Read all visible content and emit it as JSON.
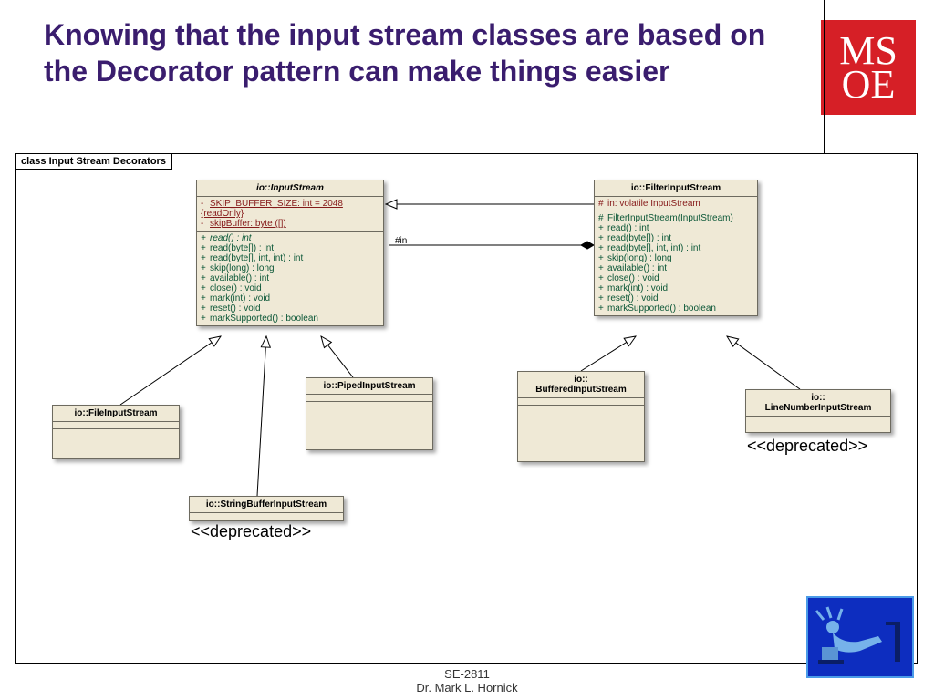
{
  "title": "Knowing that the input stream classes are based on the Decorator pattern can make things easier",
  "logo": {
    "r1": "MS",
    "r2": "OE"
  },
  "diagram_label": "class Input Stream Decorators",
  "edge_labels": {
    "in": "#in"
  },
  "classes": {
    "inputstream": {
      "name": "io::InputStream",
      "attrs": [
        {
          "vis": "-",
          "text": "SKIP_BUFFER_SIZE:  int = 2048 {readOnly}",
          "static": true
        },
        {
          "vis": "-",
          "text": "skipBuffer:  byte ([])",
          "static": true
        }
      ],
      "ops": [
        {
          "vis": "+",
          "text": "read() : int",
          "italic": true
        },
        {
          "vis": "+",
          "text": "read(byte[]) : int"
        },
        {
          "vis": "+",
          "text": "read(byte[], int, int) : int"
        },
        {
          "vis": "+",
          "text": "skip(long) : long"
        },
        {
          "vis": "+",
          "text": "available() : int"
        },
        {
          "vis": "+",
          "text": "close() : void"
        },
        {
          "vis": "+",
          "text": "mark(int) : void"
        },
        {
          "vis": "+",
          "text": "reset() : void"
        },
        {
          "vis": "+",
          "text": "markSupported() : boolean"
        }
      ]
    },
    "filter": {
      "name": "io::FilterInputStream",
      "attrs": [
        {
          "vis": "#",
          "text": "in:  volatile InputStream"
        }
      ],
      "ops": [
        {
          "vis": "#",
          "text": "FilterInputStream(InputStream)"
        },
        {
          "vis": "+",
          "text": "read() : int"
        },
        {
          "vis": "+",
          "text": "read(byte[]) : int"
        },
        {
          "vis": "+",
          "text": "read(byte[], int, int) : int"
        },
        {
          "vis": "+",
          "text": "skip(long) : long"
        },
        {
          "vis": "+",
          "text": "available() : int"
        },
        {
          "vis": "+",
          "text": "close() : void"
        },
        {
          "vis": "+",
          "text": "mark(int) : void"
        },
        {
          "vis": "+",
          "text": "reset() : void"
        },
        {
          "vis": "+",
          "text": "markSupported() : boolean"
        }
      ]
    },
    "file": {
      "name": "io::FileInputStream"
    },
    "stringbuf": {
      "name": "io::StringBufferInputStream"
    },
    "piped": {
      "name": "io::PipedInputStream"
    },
    "buffered": {
      "name": "io::\nBufferedInputStream"
    },
    "linenum": {
      "name": "io::\nLineNumberInputStream"
    }
  },
  "annotations": {
    "dep1": "<<deprecated>>",
    "dep2": "<<deprecated>>"
  },
  "footer": {
    "course": "SE-2811",
    "author": "Dr. Mark L. Hornick"
  },
  "chart_data": {
    "type": "table",
    "description": "UML class diagram illustrating Java io InputStream hierarchy as Decorator pattern",
    "nodes": [
      {
        "id": "InputStream",
        "abstract": true
      },
      {
        "id": "FilterInputStream"
      },
      {
        "id": "FileInputStream"
      },
      {
        "id": "StringBufferInputStream",
        "stereotype": "deprecated"
      },
      {
        "id": "PipedInputStream"
      },
      {
        "id": "BufferedInputStream"
      },
      {
        "id": "LineNumberInputStream",
        "stereotype": "deprecated"
      }
    ],
    "edges": [
      {
        "from": "FilterInputStream",
        "to": "InputStream",
        "type": "generalization"
      },
      {
        "from": "FileInputStream",
        "to": "InputStream",
        "type": "generalization"
      },
      {
        "from": "StringBufferInputStream",
        "to": "InputStream",
        "type": "generalization"
      },
      {
        "from": "PipedInputStream",
        "to": "InputStream",
        "type": "generalization"
      },
      {
        "from": "BufferedInputStream",
        "to": "FilterInputStream",
        "type": "generalization"
      },
      {
        "from": "LineNumberInputStream",
        "to": "FilterInputStream",
        "type": "generalization"
      },
      {
        "from": "FilterInputStream",
        "to": "InputStream",
        "type": "composition",
        "role": "#in"
      }
    ]
  }
}
